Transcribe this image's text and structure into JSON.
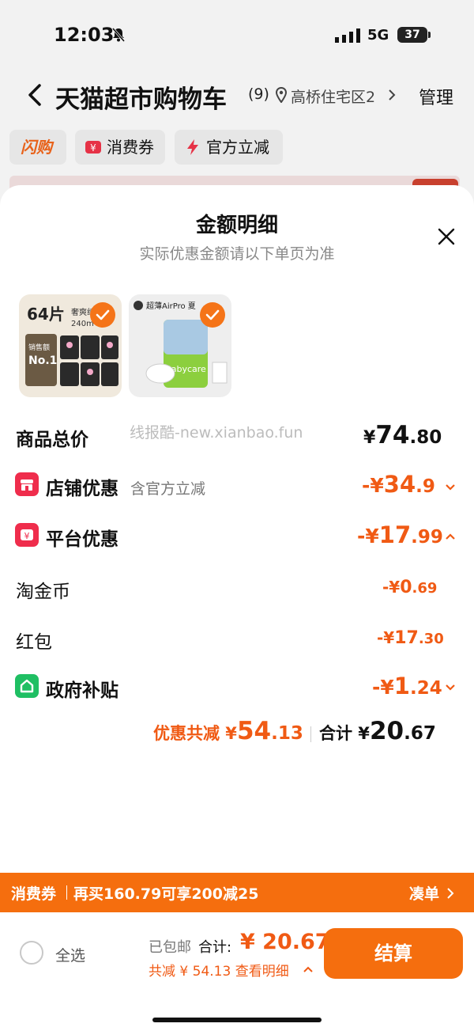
{
  "status_bar": {
    "time": "12:03",
    "network": "5G",
    "battery": "37"
  },
  "cart_page": {
    "title": "天猫超市购物车",
    "count": "(9)",
    "address": "高桥住宅区2",
    "manage": "管理",
    "filters": {
      "flash": "闪购",
      "voucher": "消费券",
      "official": "官方立减"
    }
  },
  "sheet": {
    "title": "金额明细",
    "subtitle": "实际优惠金额请以下单页为准",
    "watermark": "线报酷-new.xianbao.fun",
    "products": [
      {
        "name": "64片 奢爽纯... 240mm 销售额No.1"
      },
      {
        "name": "超薄AirPro 夏季... babycare"
      }
    ],
    "rows": {
      "goods_total": {
        "label": "商品总价",
        "currency": "¥",
        "int": "74",
        "dec": ".80"
      },
      "store_discount": {
        "label": "店铺优惠",
        "note": "含官方立减",
        "prefix": "-¥",
        "int": "34",
        "dec": ".9"
      },
      "platform_discount": {
        "label": "平台优惠",
        "prefix": "-¥",
        "int": "17",
        "dec": ".99"
      },
      "taojinbi": {
        "label": "淘金币",
        "prefix": "-¥",
        "int": "0",
        "dec": ".69"
      },
      "red_packet": {
        "label": "红包",
        "prefix": "-¥",
        "int": "17",
        "dec": ".30"
      },
      "gov_subsidy": {
        "label": "政府补贴",
        "prefix": "-¥",
        "int": "1",
        "dec": ".24"
      }
    },
    "summary": {
      "saving_label": "优惠共减 ¥",
      "saving_int": "54",
      "saving_dec": ".13",
      "total_label": "合计 ¥",
      "total_int": "20",
      "total_dec": ".67"
    }
  },
  "coupon_strip": {
    "tag": "消费券",
    "text": "再买160.79可享200减25",
    "action": "凑单"
  },
  "checkout": {
    "select_all": "全选",
    "shipping": "已包邮",
    "total_label": "合计:",
    "total_value": "¥ 20.67",
    "discount_note": "共减 ¥ 54.13 查看明细",
    "button": "结算"
  },
  "colors": {
    "accent": "#f56e0e",
    "discount": "#f05a14",
    "store_icon": "#ef2d4c",
    "gov_icon": "#1fbf63"
  }
}
